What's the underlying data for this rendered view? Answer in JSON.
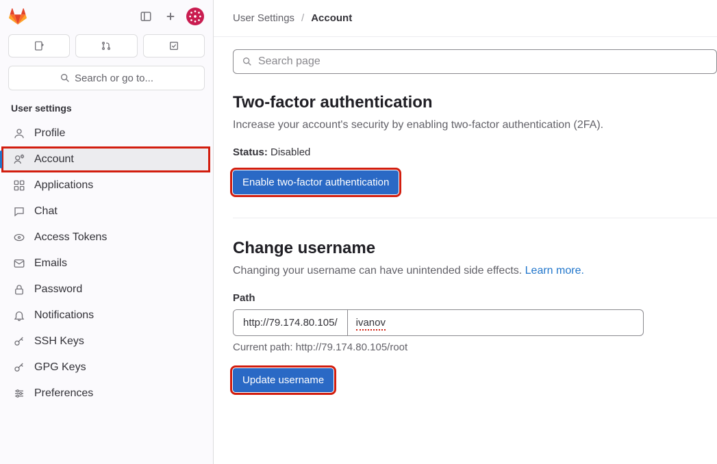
{
  "sidebar": {
    "search_label": "Search or go to...",
    "section_title": "User settings",
    "items": [
      {
        "label": "Profile"
      },
      {
        "label": "Account"
      },
      {
        "label": "Applications"
      },
      {
        "label": "Chat"
      },
      {
        "label": "Access Tokens"
      },
      {
        "label": "Emails"
      },
      {
        "label": "Password"
      },
      {
        "label": "Notifications"
      },
      {
        "label": "SSH Keys"
      },
      {
        "label": "GPG Keys"
      },
      {
        "label": "Preferences"
      }
    ]
  },
  "breadcrumb": {
    "root": "User Settings",
    "current": "Account"
  },
  "search_page_placeholder": "Search page",
  "twofa": {
    "title": "Two-factor authentication",
    "desc": "Increase your account's security by enabling two-factor authentication (2FA).",
    "status_label": "Status:",
    "status_value": "Disabled",
    "button": "Enable two-factor authentication"
  },
  "username": {
    "title": "Change username",
    "desc_prefix": "Changing your username can have unintended side effects. ",
    "learn_more": "Learn more.",
    "path_label": "Path",
    "path_prefix": "http://79.174.80.105/",
    "path_value": "ivanov",
    "current_path_label": "Current path: ",
    "current_path_value": "http://79.174.80.105/root",
    "button": "Update username"
  }
}
